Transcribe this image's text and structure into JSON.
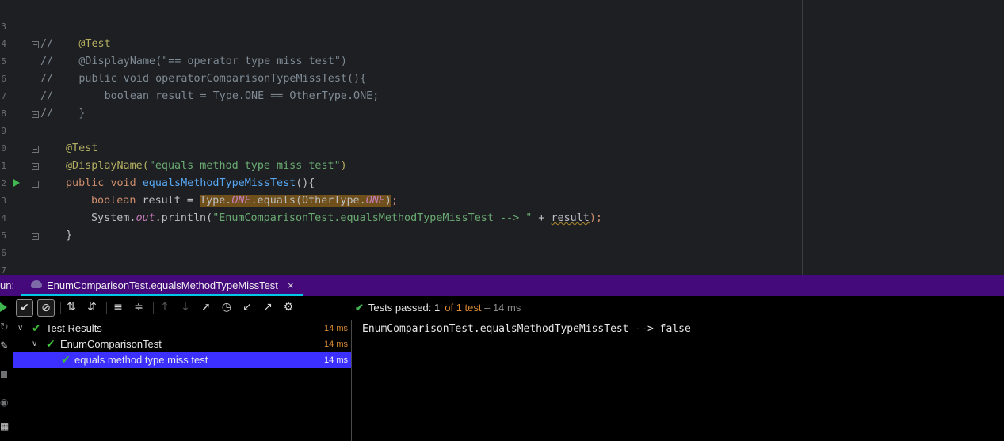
{
  "editor": {
    "line_numbers": [
      "3",
      "4",
      "5",
      "6",
      "7",
      "8",
      "9",
      "0",
      "1",
      "2",
      "3",
      "4",
      "5",
      "6",
      "7"
    ],
    "lines": {
      "l4": {
        "a": "//    ",
        "b": "@Test"
      },
      "l5": {
        "a": "//    @DisplayName(\"== operator type miss test\")"
      },
      "l6": {
        "a": "//    public void operatorComparisonTypeMissTest(){"
      },
      "l7": {
        "a": "//        boolean result = Type.ONE == OtherType.ONE;"
      },
      "l8": {
        "a": "//    }"
      },
      "l10": {
        "ann": "@Test"
      },
      "l11": {
        "ann": "@DisplayName(",
        "str": "\"equals method type miss test\"",
        "close": ")"
      },
      "l12": {
        "kw1": "public",
        "kw2": "void",
        "fn": "equalsMethodTypeMissTest",
        "rest": "(){"
      },
      "l13": {
        "kw": "boolean",
        "mid": " result = ",
        "hl_a": "Type.",
        "hl_b": "ONE",
        "hl_c": ".equals(OtherType.",
        "hl_d": "ONE",
        "hl_e": ")",
        "end": ";"
      },
      "l14": {
        "a": "System.",
        "b": "out",
        "c": ".println(",
        "str": "\"EnumComparisonTest.equalsMethodTypeMissTest --> \"",
        "d": " + ",
        "e": "result",
        "f": ");"
      },
      "l15": {
        "a": "}"
      }
    }
  },
  "run_bar": {
    "label": "un:",
    "tab_title": "EnumComparisonTest.equalsMethodTypeMissTest",
    "close_glyph": "×"
  },
  "toolbar": {
    "icons": [
      "check-icon",
      "stop-circle-icon",
      "sort-alpha-icon",
      "sort-duration-icon",
      "expand-all-icon",
      "collapse-all-icon",
      "arrow-up-icon",
      "arrow-down-icon",
      "import-tests-icon",
      "history-icon",
      "export-in-icon",
      "export-out-icon",
      "gear-icon"
    ]
  },
  "status": {
    "prefix": "Tests passed: ",
    "passed": "1",
    "of_text": "of 1 test",
    "time": " – 14 ms"
  },
  "tree": {
    "rows": [
      {
        "label": "Test Results",
        "time": "14 ms"
      },
      {
        "label": "EnumComparisonTest",
        "time": "14 ms"
      },
      {
        "label": "equals method type miss test",
        "time": "14 ms"
      }
    ]
  },
  "console": {
    "output": "EnumComparisonTest.equalsMethodTypeMissTest --> false"
  },
  "colors": {
    "run_bar": "#44097a",
    "tab_underline": "#00c8e6",
    "selection": "#3b30ff",
    "pass_green": "#3fbf3a",
    "time_orange": "#d98a32"
  }
}
